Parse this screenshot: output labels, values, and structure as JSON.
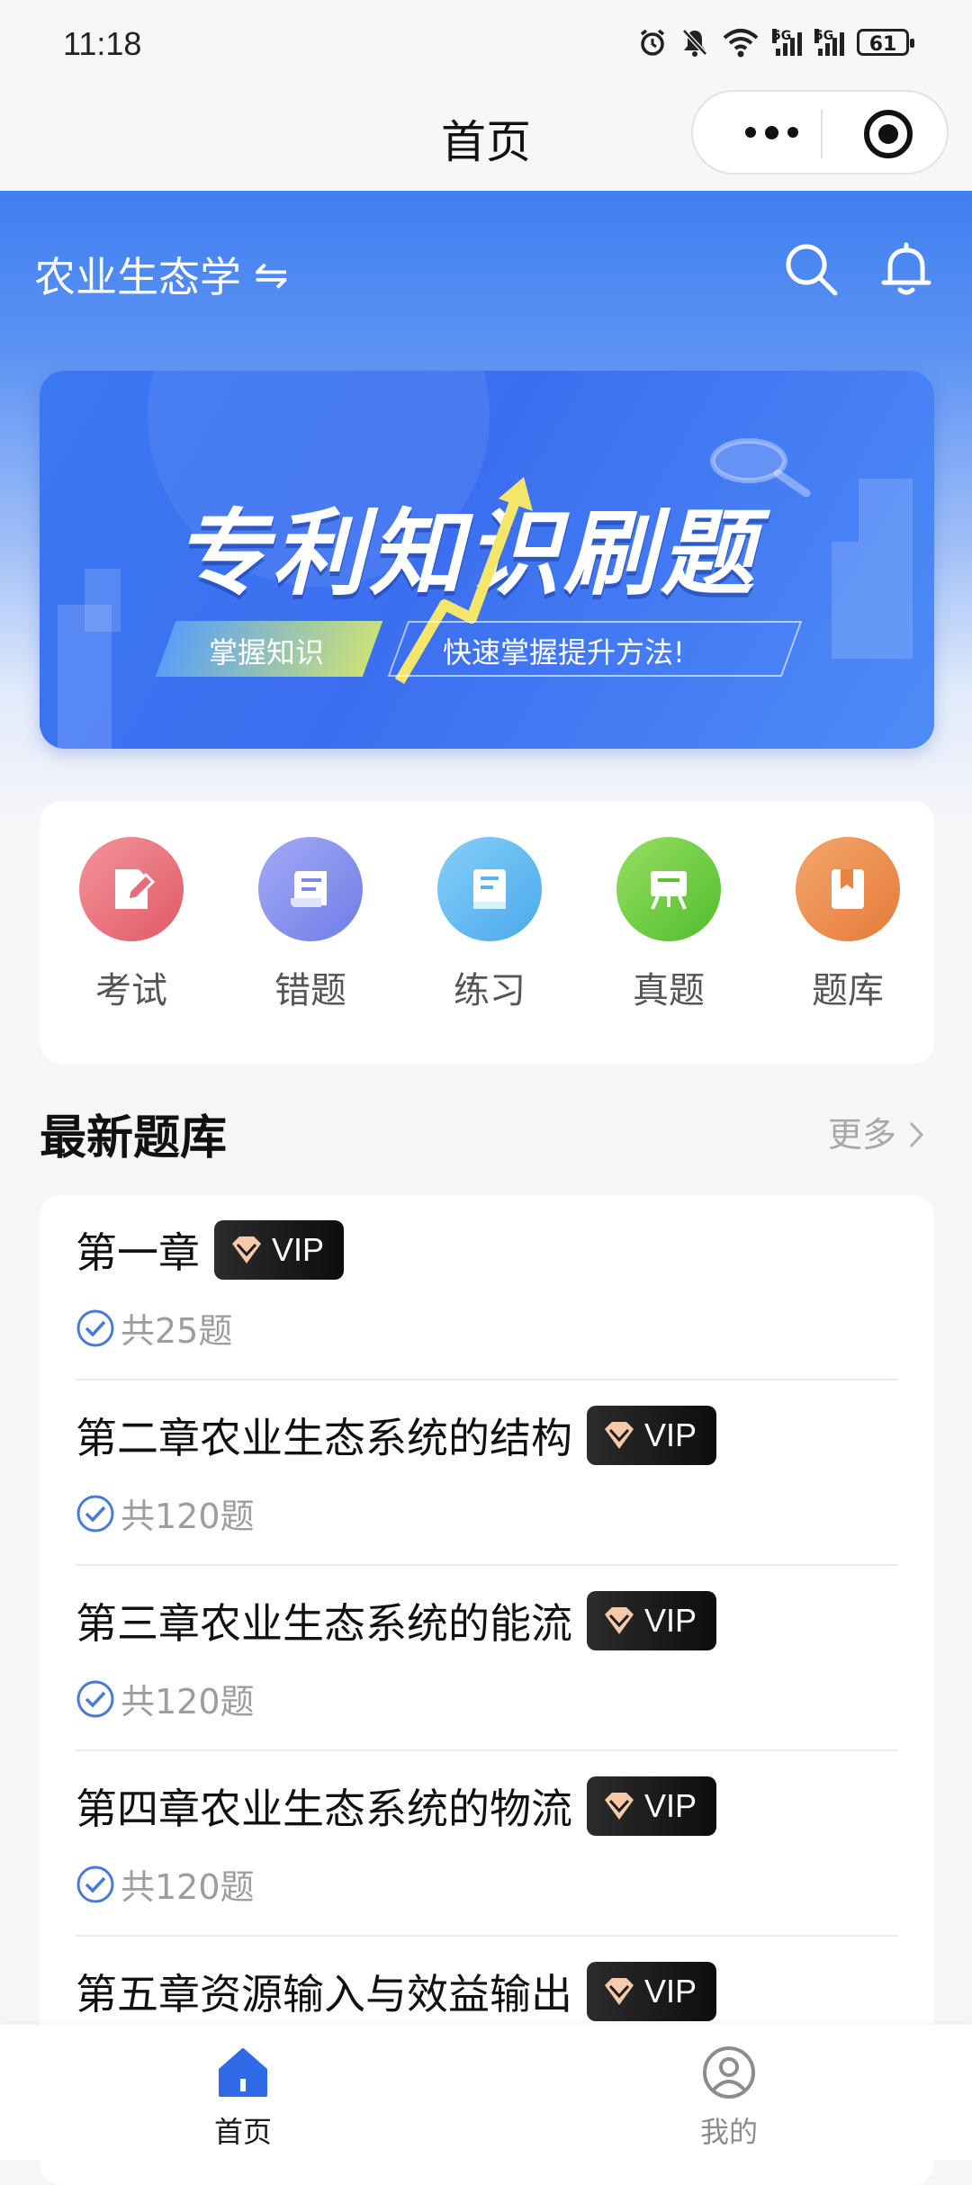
{
  "status_bar": {
    "time": "11:18",
    "battery": "61",
    "network_1": "5G",
    "network_2": "5G"
  },
  "nav": {
    "title": "首页"
  },
  "header": {
    "subject": "农业生态学",
    "swap_symbol": "⇋"
  },
  "banner": {
    "title": "专利知识刷题",
    "tag_left": "掌握知识",
    "tag_right": "快速掌握提升方法!"
  },
  "menu": [
    {
      "label": "考试",
      "icon": "exam-icon",
      "color_from": "#f08a8f",
      "color_to": "#e25d6a"
    },
    {
      "label": "错题",
      "icon": "wrong-question-icon",
      "color_from": "#9aa3f3",
      "color_to": "#6f7ee8"
    },
    {
      "label": "练习",
      "icon": "practice-book-icon",
      "color_from": "#7ec9f6",
      "color_to": "#4faee9"
    },
    {
      "label": "真题",
      "icon": "real-exam-icon",
      "color_from": "#8fdc5c",
      "color_to": "#55c130"
    },
    {
      "label": "题库",
      "icon": "question-bank-icon",
      "color_from": "#f3a066",
      "color_to": "#e77d3c"
    }
  ],
  "section": {
    "title": "最新题库",
    "more": "更多"
  },
  "vip_label": "VIP",
  "items": [
    {
      "title": "第一章",
      "count": "共25题"
    },
    {
      "title": "第二章农业生态系统的结构",
      "count": "共120题"
    },
    {
      "title": "第三章农业生态系统的能流",
      "count": "共120题"
    },
    {
      "title": "第四章农业生态系统的物流",
      "count": "共120题"
    },
    {
      "title": "第五章资源输入与效益输出",
      "count": ""
    }
  ],
  "tabs": [
    {
      "label": "首页",
      "icon": "home-icon",
      "active": true
    },
    {
      "label": "我的",
      "icon": "profile-icon",
      "active": false
    }
  ],
  "colors": {
    "primary": "#3f7ff0",
    "active_tab": "#2f6be6",
    "inactive_tab": "#8c8c8c"
  }
}
